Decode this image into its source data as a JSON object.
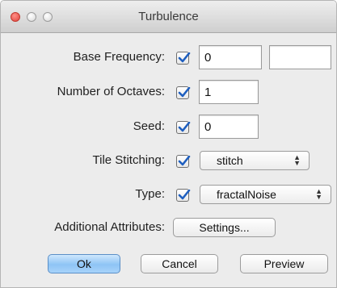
{
  "window": {
    "title": "Turbulence"
  },
  "rows": {
    "base_frequency": {
      "label": "Base Frequency:",
      "checked": true,
      "value": "0",
      "value2": ""
    },
    "num_octaves": {
      "label": "Number of Octaves:",
      "checked": true,
      "value": "1"
    },
    "seed": {
      "label": "Seed:",
      "checked": true,
      "value": "0"
    },
    "tile_stitching": {
      "label": "Tile Stitching:",
      "checked": true,
      "selected": "stitch"
    },
    "type": {
      "label": "Type:",
      "checked": true,
      "selected": "fractalNoise"
    },
    "additional": {
      "label": "Additional Attributes:",
      "button_label": "Settings..."
    }
  },
  "buttons": {
    "ok": "Ok",
    "cancel": "Cancel",
    "preview": "Preview"
  },
  "colors": {
    "checkmark": "#1f5fbf",
    "default_button": "#8ec4f5"
  },
  "icons": {
    "popup_arrows": "up-down-arrows-icon",
    "checkmark": "checkmark-icon"
  }
}
